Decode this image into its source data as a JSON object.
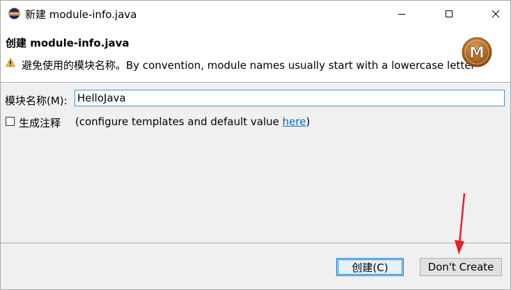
{
  "window": {
    "title": "新建 module-info.java",
    "app_icon": "eclipse-icon",
    "controls": [
      "minimize-icon",
      "maximize-icon",
      "close-icon"
    ]
  },
  "header": {
    "title": "创建 module-info.java",
    "message": "避免使用的模块名称。By convention, module names usually start with a lowercase letter",
    "warning_icon": "warning-icon",
    "logo_icon": "module-wizard-logo-icon",
    "logo_letter": "M"
  },
  "form": {
    "module_name_label": "模块名称(M):",
    "module_name_value": "HelloJava",
    "generate_comments_label": "生成注释",
    "generate_comments_checked": false,
    "configure_prefix": "(configure templates and default value ",
    "configure_link": "here",
    "configure_suffix": ")"
  },
  "buttons": {
    "create_label": "创建(C)",
    "dont_create_label": "Don't Create"
  },
  "annotation": {
    "arrow_color": "#e8202a"
  },
  "colors": {
    "link": "#0066cc",
    "focus_border": "#0078d7",
    "warning": "#f2c037"
  }
}
